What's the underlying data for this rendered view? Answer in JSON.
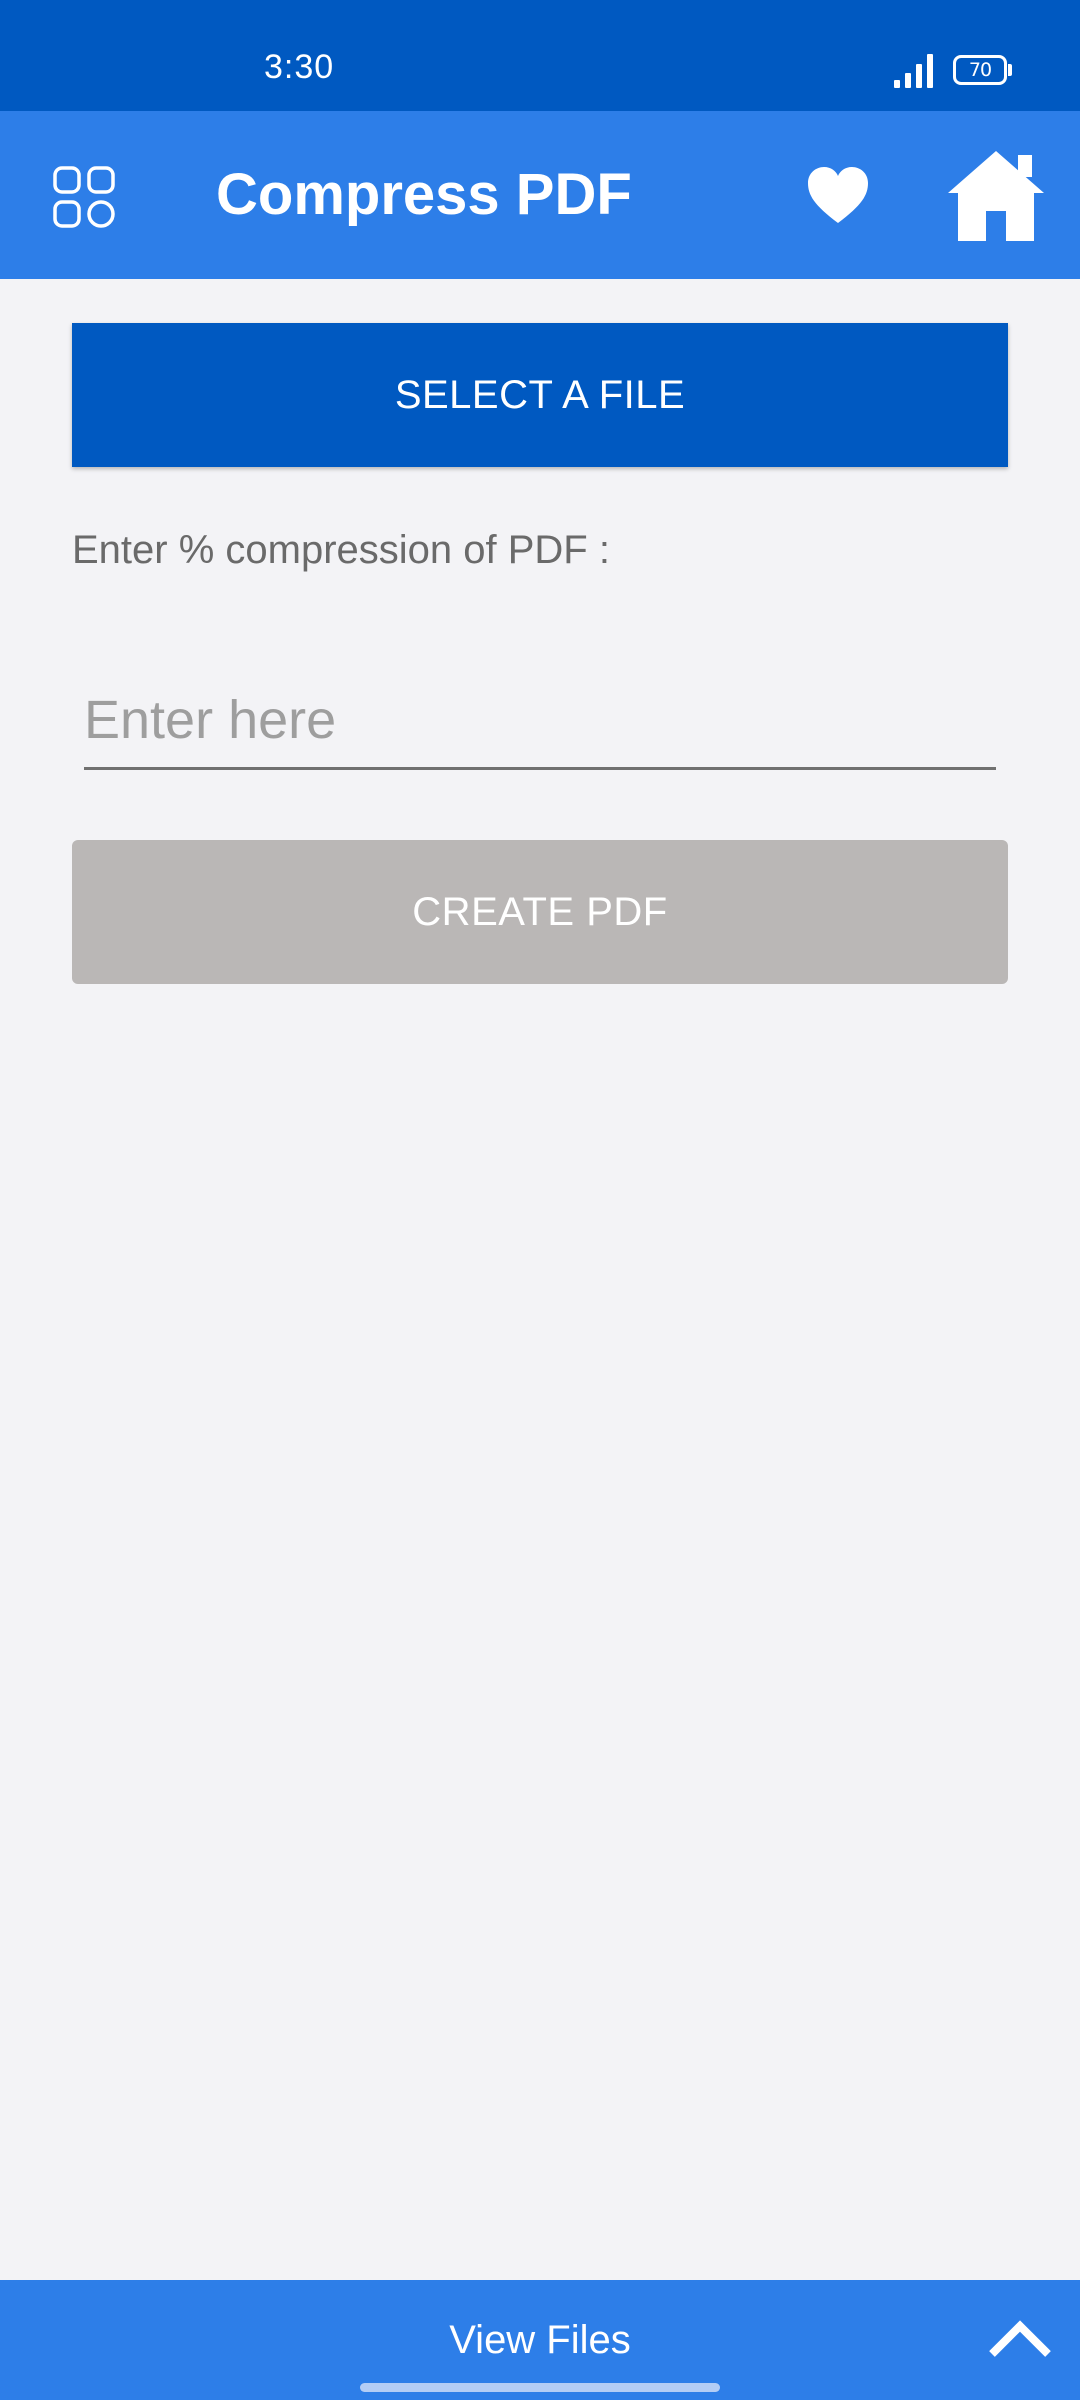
{
  "status_bar": {
    "time": "3:30",
    "battery_level": "70",
    "icons": [
      "signal-icon",
      "battery-icon"
    ]
  },
  "app_bar": {
    "title": "Compress PDF",
    "icons": [
      "menu-grid-icon",
      "heart-icon",
      "home-icon"
    ]
  },
  "main": {
    "select_button_label": "SELECT A FILE",
    "compression_label": "Enter % compression of PDF :",
    "compression_input": {
      "value": "",
      "placeholder": "Enter here"
    },
    "create_button_label": "CREATE PDF"
  },
  "bottom_bar": {
    "label": "View Files",
    "icon": "chevron-up-icon"
  },
  "colors": {
    "status_bar": "#0059c1",
    "app_bar": "#2d7ee8",
    "primary_button": "#0059c1",
    "disabled_button": "#bab7b6",
    "background": "#f3f3f6"
  }
}
